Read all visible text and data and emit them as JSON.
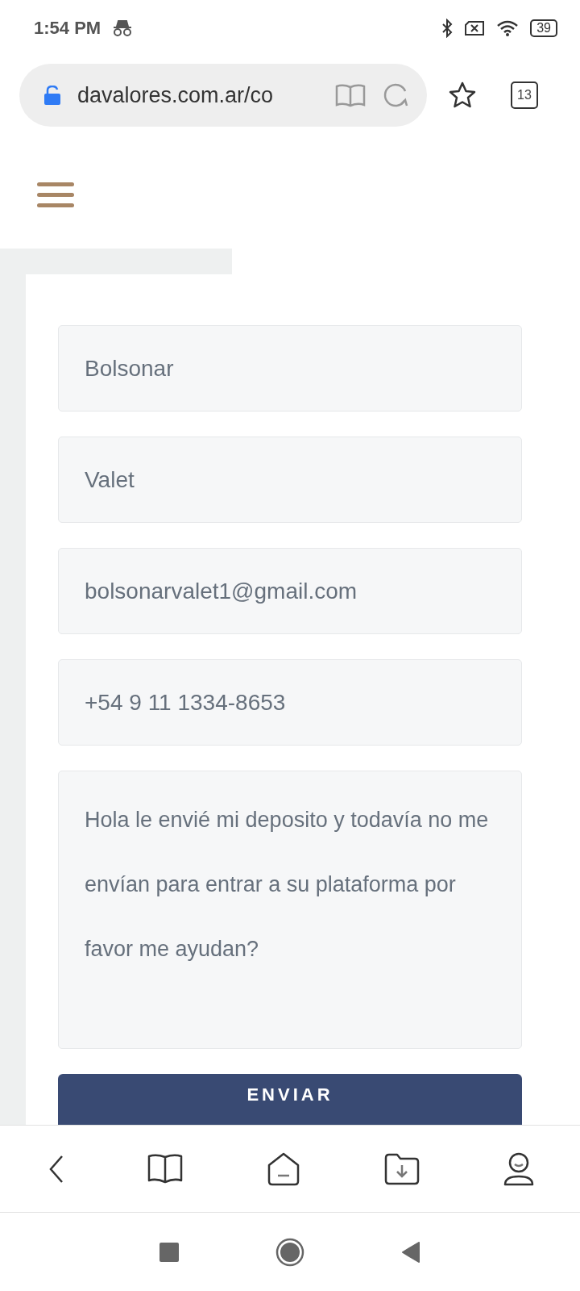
{
  "status_bar": {
    "time": "1:54 PM",
    "battery": "39"
  },
  "browser_bar": {
    "url": "davalores.com.ar/co",
    "tab_count": "13"
  },
  "form": {
    "fields": [
      {
        "value": "Bolsonar"
      },
      {
        "value": "Valet"
      },
      {
        "value": "bolsonarvalet1@gmail.com"
      },
      {
        "value": "+54 9 11 1334-8653"
      }
    ],
    "message": "Hola le envié mi deposito y todavía no me envían para entrar a su plataforma por favor me ayudan?",
    "submit": "ENVIAR"
  }
}
